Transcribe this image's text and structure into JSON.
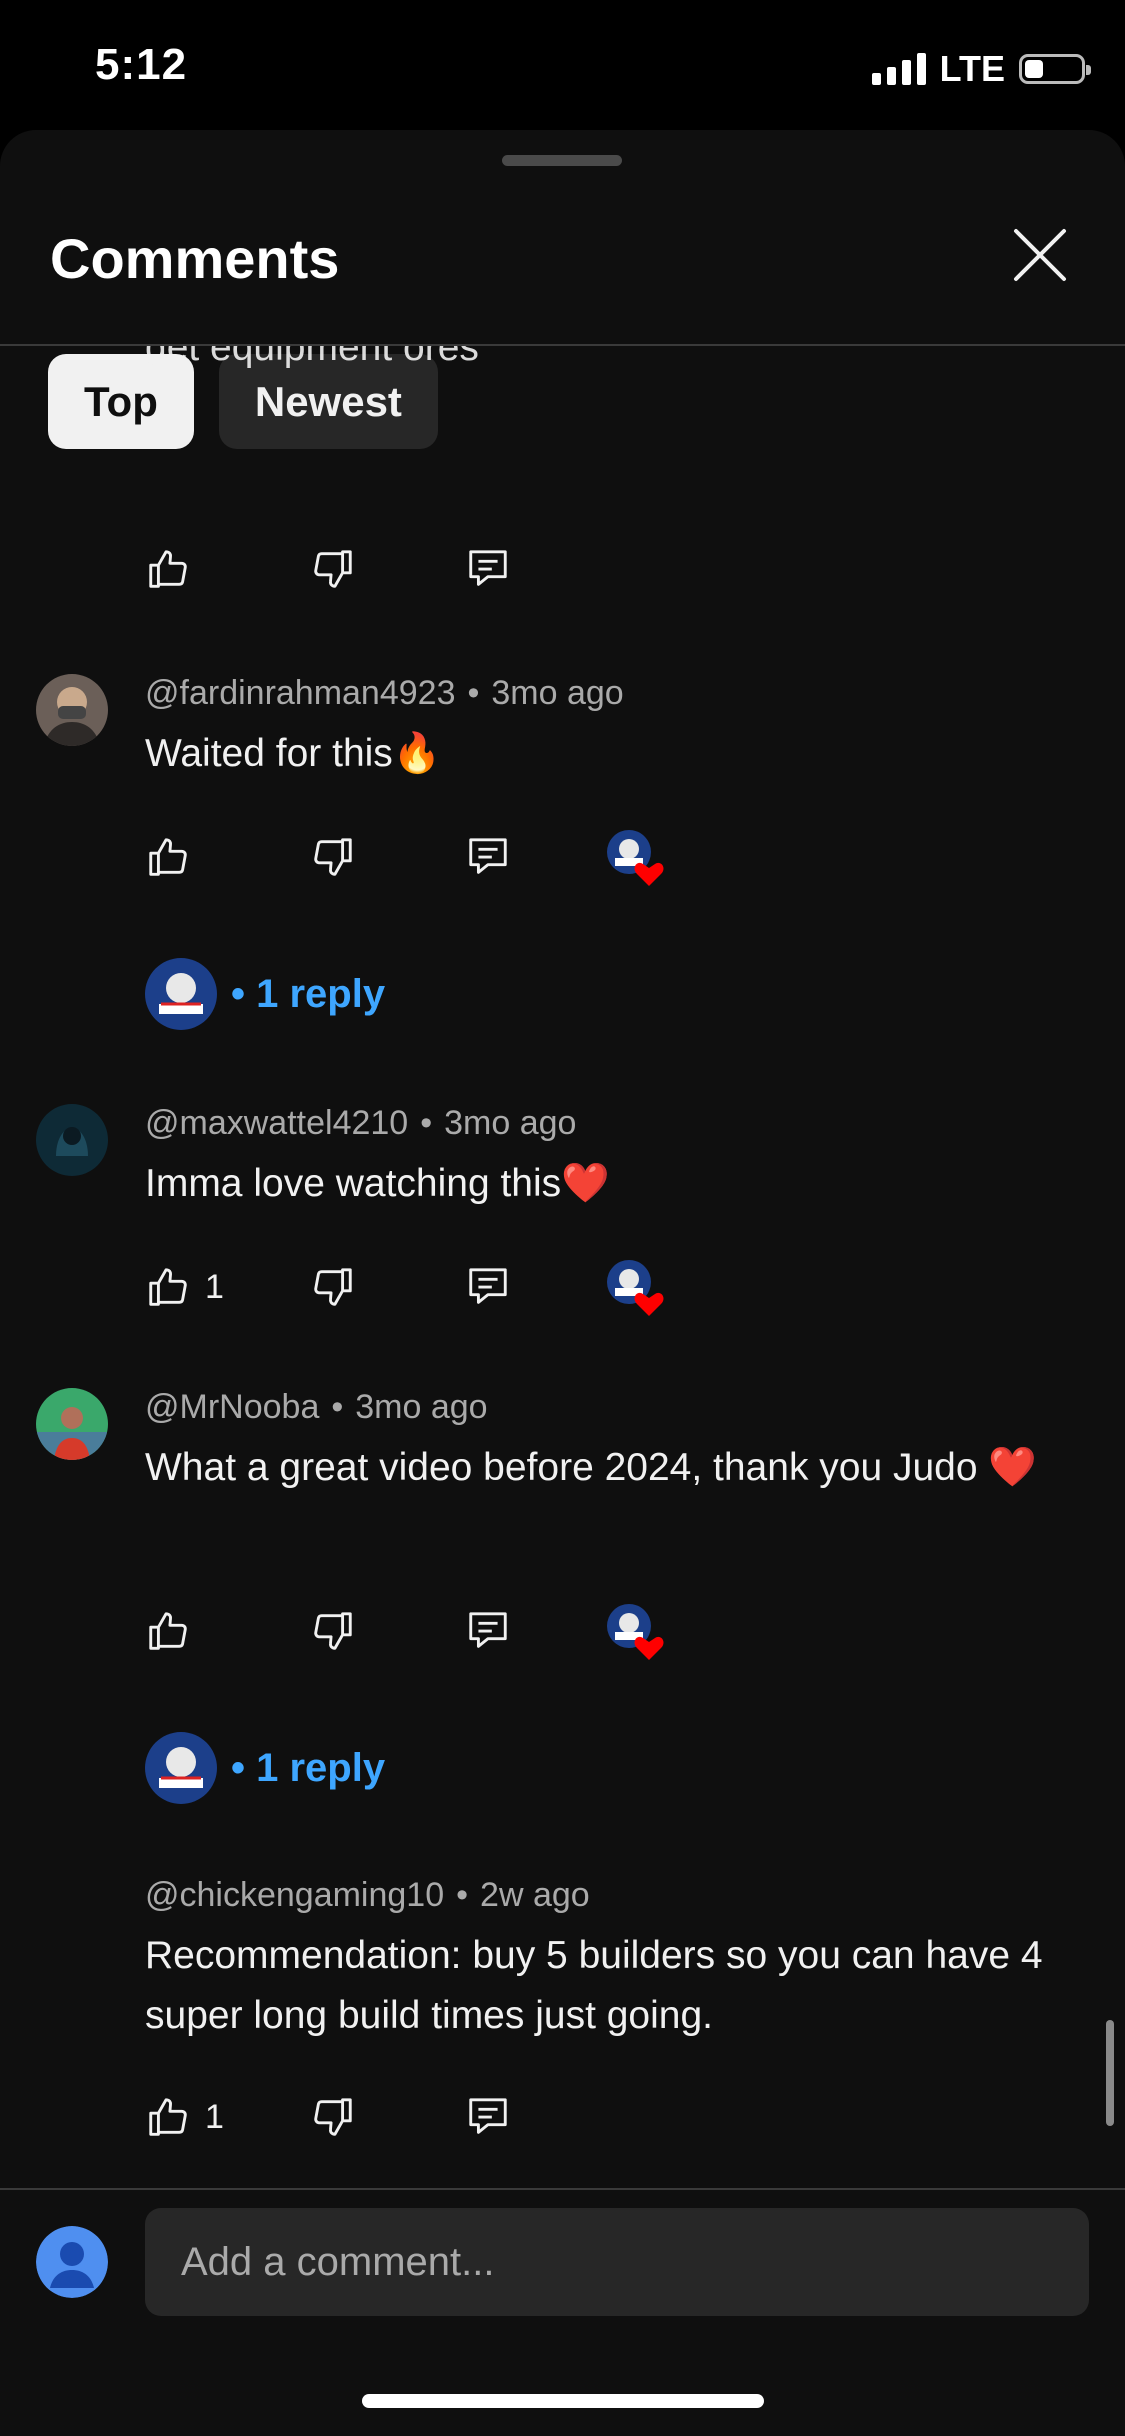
{
  "status_bar": {
    "time": "5:12",
    "network": "LTE"
  },
  "sheet": {
    "title": "Comments",
    "tabs": [
      {
        "label": "Top",
        "selected": true
      },
      {
        "label": "Newest",
        "selected": false
      }
    ]
  },
  "partial_comment_text": "get equipment ores",
  "comments": [
    {
      "author": "@fardinrahman4923",
      "time": "3mo ago",
      "text": "Waited for this🔥",
      "likes": "",
      "hearted": true,
      "replies": "• 1 reply"
    },
    {
      "author": "@maxwattel4210",
      "time": "3mo ago",
      "text": "Imma love watching this❤️",
      "likes": "1",
      "hearted": true,
      "replies": ""
    },
    {
      "author": "@MrNooba",
      "time": "3mo ago",
      "text": "What a great video before 2024, thank you Judo ❤️",
      "likes": "",
      "hearted": true,
      "replies": "• 1 reply"
    },
    {
      "author": "@chickengaming10",
      "time": "2w ago",
      "text": "Recommendation: buy 5 builders so you can have 4 super long build times just going.",
      "likes": "1",
      "hearted": false,
      "replies": ""
    }
  ],
  "separator": "•",
  "icons": [
    "like-icon",
    "dislike-icon",
    "reply-icon",
    "creator-heart-icon",
    "close-icon"
  ],
  "composer": {
    "placeholder": "Add a comment..."
  },
  "colors": {
    "background": "#0f0f0f",
    "accent": "#3ea6ff",
    "heart": "#ff0000"
  }
}
